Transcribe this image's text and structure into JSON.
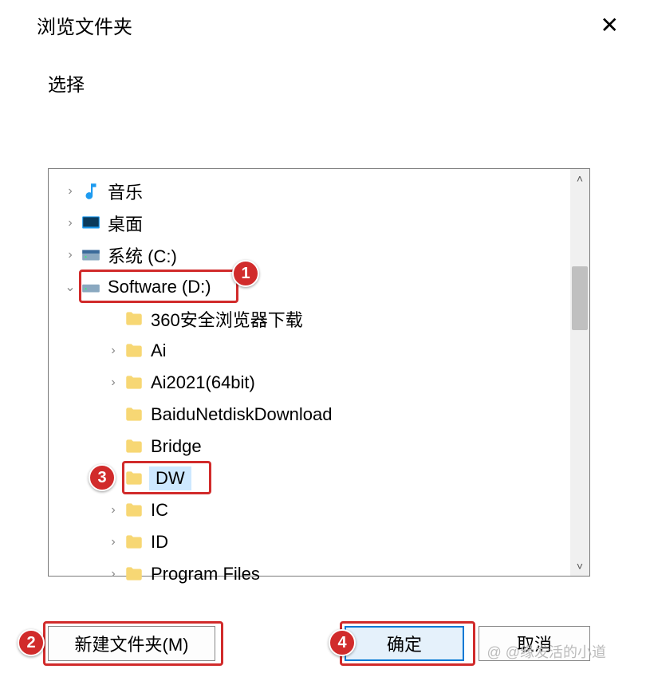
{
  "dialog": {
    "title": "浏览文件夹",
    "close_label": "✕",
    "instruction": "选择"
  },
  "tree": {
    "items": [
      {
        "expander": "›",
        "indent": 0,
        "icon": "music",
        "label": "音乐"
      },
      {
        "expander": "›",
        "indent": 0,
        "icon": "desktop",
        "label": "桌面"
      },
      {
        "expander": "›",
        "indent": 0,
        "icon": "drive-sys",
        "label": "系统 (C:)"
      },
      {
        "expander": "⌄",
        "indent": 0,
        "icon": "drive",
        "label": "Software (D:)",
        "highlight_box": true,
        "annot": 1
      },
      {
        "expander": "",
        "indent": 1,
        "icon": "folder",
        "label": "360安全浏览器下载"
      },
      {
        "expander": "›",
        "indent": 1,
        "icon": "folder",
        "label": "Ai"
      },
      {
        "expander": "›",
        "indent": 1,
        "icon": "folder",
        "label": "Ai2021(64bit)"
      },
      {
        "expander": "",
        "indent": 1,
        "icon": "folder",
        "label": "BaiduNetdiskDownload"
      },
      {
        "expander": "",
        "indent": 1,
        "icon": "folder",
        "label": "Bridge"
      },
      {
        "expander": "",
        "indent": 1,
        "icon": "folder",
        "label": "DW",
        "selected": true,
        "highlight_box": true,
        "annot": 3
      },
      {
        "expander": "›",
        "indent": 1,
        "icon": "folder",
        "label": "IC"
      },
      {
        "expander": "›",
        "indent": 1,
        "icon": "folder",
        "label": "ID"
      },
      {
        "expander": "›",
        "indent": 1,
        "icon": "folder",
        "label": "Program Files"
      }
    ]
  },
  "buttons": {
    "new_folder": "新建文件夹(M)",
    "ok": "确定",
    "cancel": "取消"
  },
  "annotations": {
    "new_folder_num": "2",
    "ok_num": "4"
  },
  "watermark": "@ @缘发活的小道"
}
